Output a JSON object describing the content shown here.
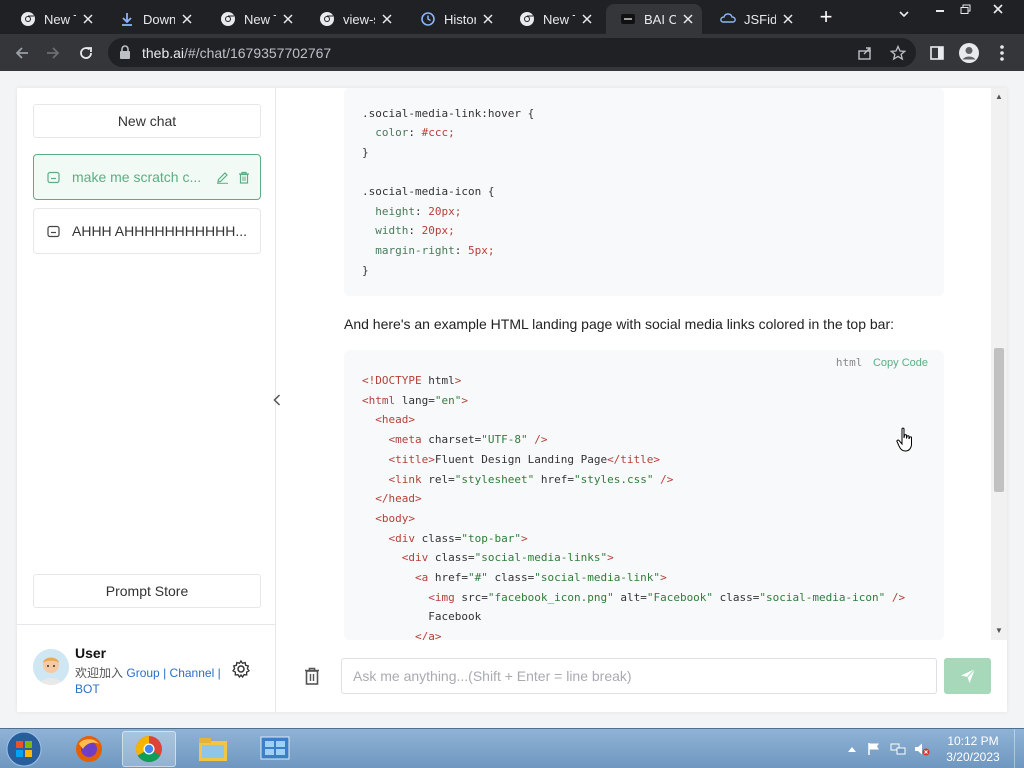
{
  "browser": {
    "tabs": [
      {
        "title": "New T",
        "icon": "chrome-icon",
        "active": false
      },
      {
        "title": "Downl",
        "icon": "download-icon",
        "active": false
      },
      {
        "title": "New T",
        "icon": "chrome-icon",
        "active": false
      },
      {
        "title": "view-s",
        "icon": "chrome-icon",
        "active": false
      },
      {
        "title": "Histor",
        "icon": "history-icon",
        "active": false
      },
      {
        "title": "New T",
        "icon": "chrome-icon",
        "active": false
      },
      {
        "title": "BAI Ch",
        "icon": "bai-icon",
        "active": true
      },
      {
        "title": "JSFidd",
        "icon": "jsfiddle-icon",
        "active": false
      }
    ],
    "url_host": "theb.ai",
    "url_path": "/#/chat/1679357702767"
  },
  "sidebar": {
    "new_chat_label": "New chat",
    "chats": [
      {
        "title": "make me scratch c...",
        "active": true
      },
      {
        "title": "AHHH AHHHHHHHHHHH...",
        "active": false
      }
    ],
    "prompt_store_label": "Prompt Store",
    "user": {
      "name": "User",
      "join_text": "欢迎加入",
      "link_group": "Group",
      "sep1": "|",
      "link_channel": "Channel",
      "sep2": "|",
      "link_bot": "BOT"
    }
  },
  "chat": {
    "css_code": [
      ".social-media-link:hover {",
      "  color: #ccc;",
      "}",
      "",
      ".social-media-icon {",
      "  height: 20px;",
      "  width: 20px;",
      "  margin-right: 5px;",
      "}"
    ],
    "message": "And here's an example HTML landing page with social media links colored in the top bar:",
    "html_code_lang": "html",
    "copy_code_label": "Copy Code",
    "html_code": [
      "<!DOCTYPE html>",
      "<html lang=\"en\">",
      "  <head>",
      "    <meta charset=\"UTF-8\" />",
      "    <title>Fluent Design Landing Page</title>",
      "    <link rel=\"stylesheet\" href=\"styles.css\" />",
      "  </head>",
      "  <body>",
      "    <div class=\"top-bar\">",
      "      <div class=\"social-media-links\">",
      "        <a href=\"#\" class=\"social-media-link\">",
      "          <img src=\"facebook_icon.png\" alt=\"Facebook\" class=\"social-media-icon\" />",
      "          Facebook",
      "        </a>"
    ],
    "input_placeholder": "Ask me anything...(Shift + Enter = line break)"
  },
  "taskbar": {
    "time": "10:12 PM",
    "date": "3/20/2023"
  },
  "colors": {
    "accent": "#5cae82",
    "send_button": "#a6d8b9",
    "browser_dark": "#202124"
  }
}
